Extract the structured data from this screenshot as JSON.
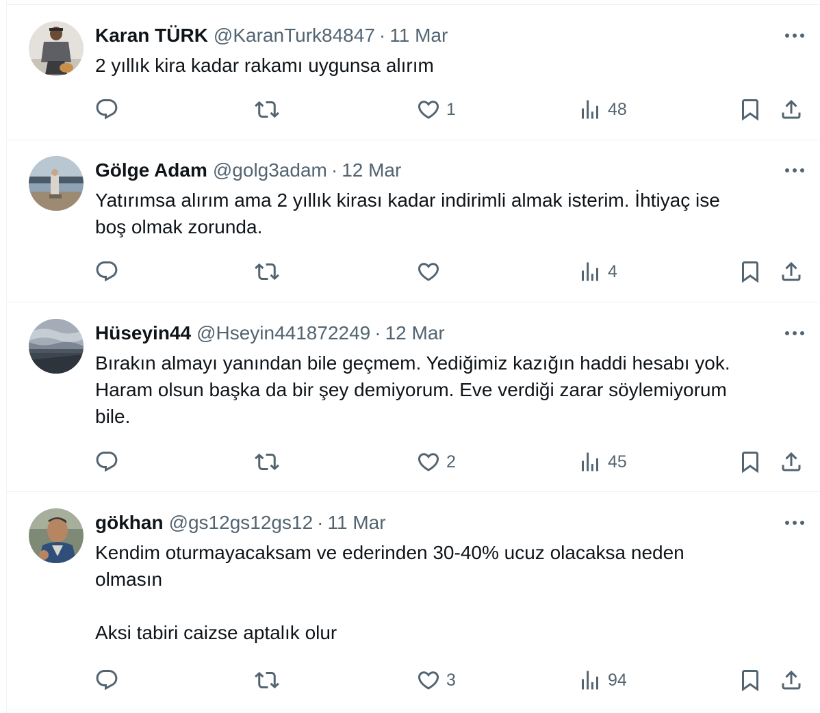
{
  "tweets": [
    {
      "name": "Karan TÜRK",
      "handle": "@KaranTurk84847",
      "separator": "·",
      "date": "11 Mar",
      "text": "2 yıllık kira kadar rakamı uygunsa alırım",
      "replies": "",
      "retweets": "",
      "likes": "1",
      "views": "48"
    },
    {
      "name": "Gölge Adam",
      "handle": "@golg3adam",
      "separator": "·",
      "date": "12 Mar",
      "text": "Yatırımsa alırım ama 2 yıllık kirası kadar indirimli almak isterim. İhtiyaç ise\nboş olmak zorunda.",
      "replies": "",
      "retweets": "",
      "likes": "",
      "views": "4"
    },
    {
      "name": "Hüseyin44",
      "handle": "@Hseyin441872249",
      "separator": "·",
      "date": "12 Mar",
      "text": "Bırakın almayı yanından bile geçmem. Yediğimiz kazığın haddi hesabı yok.\nHaram olsun başka da bir şey demiyorum. Eve verdiği zarar söylemiyorum\nbile.",
      "replies": "",
      "retweets": "",
      "likes": "2",
      "views": "45"
    },
    {
      "name": "gökhan",
      "handle": "@gs12gs12gs12",
      "separator": "·",
      "date": "11 Mar",
      "text": "Kendim oturmayacaksam ve ederinden 30-40% ucuz olacaksa neden\nolmasın\n\nAksi tabiri caizse aptalık olur",
      "replies": "",
      "retweets": "",
      "likes": "3",
      "views": "94"
    }
  ],
  "icons": {
    "more": "more-horizontal-icon",
    "reply": "reply-icon",
    "retweet": "retweet-icon",
    "like": "heart-icon",
    "views": "views-icon",
    "bookmark": "bookmark-icon",
    "share": "share-icon"
  },
  "colors": {
    "text": "#0f1419",
    "secondary": "#536471",
    "divider": "#eff3f4"
  }
}
